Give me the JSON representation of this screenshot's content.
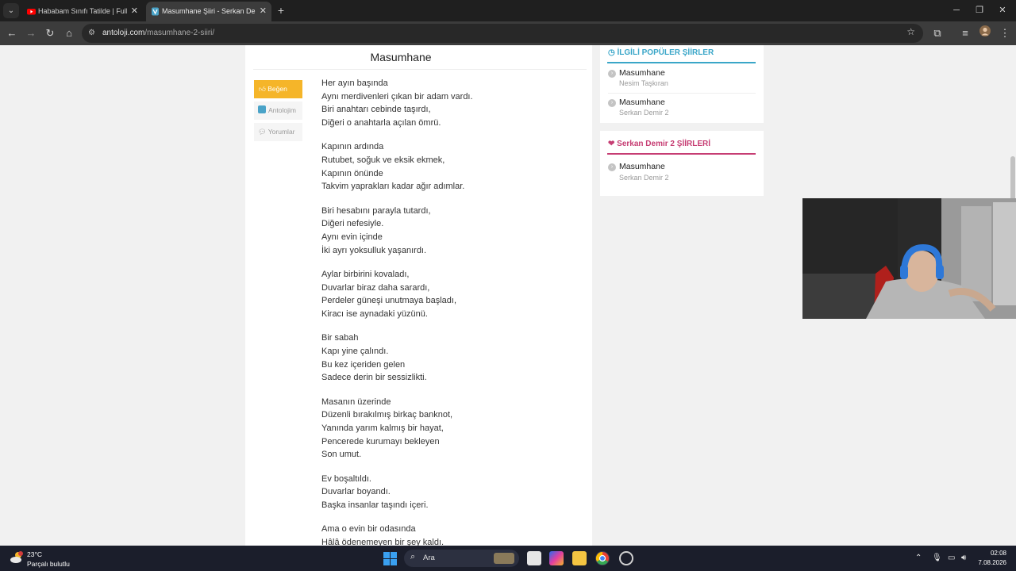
{
  "browser": {
    "tabs": [
      {
        "title": "Hababam Sınıfı Tatilde | Full HD",
        "favicon": "youtube-icon",
        "active": false
      },
      {
        "title": "Masumhane Şiiri - Serkan Demir",
        "favicon": "antoloji-icon",
        "active": true
      }
    ],
    "new_tab": "+",
    "url_host": "antoloji.com",
    "url_path": "/masumhane-2-siiri/"
  },
  "page": {
    "poem_title": "Masumhane",
    "actions": {
      "like": "Beğen",
      "antolojim": "Antolojim",
      "comments": "Yorumlar"
    },
    "stanzas": [
      [
        "Her ayın başında",
        "Aynı merdivenleri çıkan bir adam vardı.",
        "Biri anahtarı cebinde taşırdı,",
        "Diğeri o anahtarla açılan ömrü."
      ],
      [
        "Kapının ardında",
        "Rutubet, soğuk ve eksik ekmek,",
        "Kapının önünde",
        "Takvim yaprakları kadar ağır adımlar."
      ],
      [
        "Biri hesabını parayla tutardı,",
        "Diğeri nefesiyle.",
        "Aynı evin içinde",
        "İki ayrı yoksulluk yaşanırdı."
      ],
      [
        "Aylar birbirini kovaladı,",
        "Duvarlar biraz daha sarardı,",
        "Perdeler güneşi unutmaya başladı,",
        "Kiracı ise aynadaki yüzünü."
      ],
      [
        "Bir sabah",
        "Kapı yine çalındı.",
        "Bu kez içeriden gelen",
        "Sadece derin bir sessizlikti."
      ],
      [
        "Masanın üzerinde",
        "Düzenli bırakılmış birkaç banknot,",
        "Yanında yarım kalmış bir hayat,",
        "Pencerede kurumayı bekleyen",
        "Son umut."
      ],
      [
        "Ev boşaltıldı.",
        "Duvarlar boyandı.",
        "Başka insanlar taşındı içeri."
      ],
      [
        "Ama o evin bir odasında",
        "Hâlâ ödenemeyen bir şey kaldı."
      ]
    ]
  },
  "sidebar": {
    "popular": {
      "heading": "İLGİLİ POPÜLER ŞİİRLER",
      "color": "#3aa6c8",
      "items": [
        {
          "title": "Masumhane",
          "author": "Nesim Taşkıran"
        },
        {
          "title": "Masumhane",
          "author": "Serkan Demir 2"
        }
      ]
    },
    "author_poems": {
      "heading": "Serkan Demir 2 ŞİİRLERİ",
      "color": "#c63d73",
      "items": [
        {
          "title": "Masumhane",
          "author": "Serkan Demir 2"
        }
      ]
    }
  },
  "taskbar": {
    "weather_temp": "23°C",
    "weather_desc": "Parçalı bulutlu",
    "search_label": "Ara",
    "time": "02:08",
    "date": "7.08.2026"
  }
}
